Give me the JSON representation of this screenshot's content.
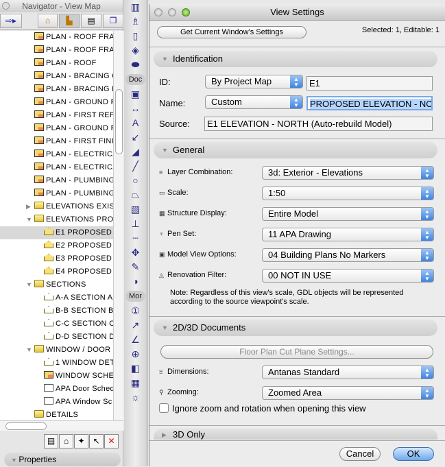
{
  "navigator": {
    "title": "Navigator - View Map",
    "properties_label": "Properties",
    "tree": [
      {
        "label": "PLAN - ROOF FRA",
        "type": "plan",
        "level": 2
      },
      {
        "label": "PLAN - ROOF FRA",
        "type": "plan",
        "level": 2
      },
      {
        "label": "PLAN - ROOF",
        "type": "plan",
        "level": 2
      },
      {
        "label": "PLAN - BRACING G",
        "type": "plan",
        "level": 2
      },
      {
        "label": "PLAN - BRACING F",
        "type": "plan",
        "level": 2
      },
      {
        "label": "PLAN - GROUND R",
        "type": "plan",
        "level": 2
      },
      {
        "label": "PLAN - FIRST REFL",
        "type": "plan",
        "level": 2
      },
      {
        "label": "PLAN - GROUND F",
        "type": "plan",
        "level": 2
      },
      {
        "label": "PLAN - FIRST FINIS",
        "type": "plan",
        "level": 2
      },
      {
        "label": "PLAN - ELECTRICA",
        "type": "plan",
        "level": 2
      },
      {
        "label": "PLAN - ELECTRICA",
        "type": "plan",
        "level": 2
      },
      {
        "label": "PLAN - PLUMBING",
        "type": "plan",
        "level": 2
      },
      {
        "label": "PLAN - PLUMBING",
        "type": "plan",
        "level": 2
      },
      {
        "label": "ELEVATIONS EXIST",
        "type": "folder",
        "level": 2,
        "arrow": "collapsed"
      },
      {
        "label": "ELEVATIONS PROP",
        "type": "folder",
        "level": 2,
        "arrow": "expanded"
      },
      {
        "label": "E1 PROPOSED E",
        "type": "elev",
        "level": 3,
        "selected": true
      },
      {
        "label": "E2 PROPOSED E",
        "type": "elev",
        "level": 3
      },
      {
        "label": "E3 PROPOSED E",
        "type": "elev",
        "level": 3
      },
      {
        "label": "E4 PROPOSED E",
        "type": "elev",
        "level": 3
      },
      {
        "label": "SECTIONS",
        "type": "folder",
        "level": 2,
        "arrow": "expanded"
      },
      {
        "label": "A-A SECTION A",
        "type": "sect",
        "level": 3
      },
      {
        "label": "B-B SECTION B-",
        "type": "sect",
        "level": 3
      },
      {
        "label": "C-C SECTION C",
        "type": "sect",
        "level": 3
      },
      {
        "label": "D-D SECTION D",
        "type": "sect",
        "level": 3
      },
      {
        "label": "WINDOW / DOOR",
        "type": "folder",
        "level": 2,
        "arrow": "expanded"
      },
      {
        "label": "1 WINDOW DET",
        "type": "sect",
        "level": 3
      },
      {
        "label": "WINDOW SCHED",
        "type": "plan",
        "level": 3
      },
      {
        "label": "APA Door Sched",
        "type": "doc",
        "level": 3
      },
      {
        "label": "APA Window Sc",
        "type": "doc",
        "level": 3
      },
      {
        "label": "DETAILS",
        "type": "folder",
        "level": 2
      }
    ]
  },
  "toolbox": {
    "doc_label": "Doc",
    "more_label": "Mor"
  },
  "dialog": {
    "title": "View Settings",
    "get_settings_label": "Get Current Window's Settings",
    "selection_status": "Selected: 1, Editable: 1",
    "identification": {
      "header": "Identification",
      "id_label": "ID:",
      "id_mode": "By Project Map",
      "id_value": "E1",
      "name_label": "Name:",
      "name_mode": "Custom",
      "name_value": "PROPOSED ELEVATION - NORTH",
      "source_label": "Source:",
      "source_value": "E1 ELEVATION - NORTH (Auto-rebuild Model)"
    },
    "general": {
      "header": "General",
      "rows": [
        {
          "label": "Layer Combination:",
          "value": "3d: Exterior - Elevations",
          "icon": "layers-icon",
          "glyph": "≡"
        },
        {
          "label": "Scale:",
          "value": "1:50",
          "icon": "scale-icon",
          "glyph": "▭"
        },
        {
          "label": "Structure Display:",
          "value": "Entire Model",
          "icon": "structure-icon",
          "glyph": "▦"
        },
        {
          "label": "Pen Set:",
          "value": "11 APA Drawing",
          "icon": "pen-icon",
          "glyph": "♆"
        },
        {
          "label": "Model View Options:",
          "value": "04 Building Plans No Markers",
          "icon": "model-view-icon",
          "glyph": "▣"
        },
        {
          "label": "Renovation Filter:",
          "value": "00 NOT IN USE",
          "icon": "renovation-icon",
          "glyph": "◬"
        }
      ],
      "note": "Note: Regardless of this view's scale, GDL objects will be represented according to the source viewpoint's scale."
    },
    "documents": {
      "header": "2D/3D Documents",
      "cut_plane_label": "Floor Plan Cut Plane Settings...",
      "rows": [
        {
          "label": "Dimensions:",
          "value": "Antanas Standard",
          "icon": "dimensions-icon",
          "glyph": "⩸"
        },
        {
          "label": "Zooming:",
          "value": "Zoomed Area",
          "icon": "zoom-icon",
          "glyph": "⚲"
        }
      ],
      "ignore_zoom_label": "Ignore zoom and rotation when opening this view",
      "ignore_zoom_checked": false
    },
    "three_d": {
      "header": "3D Only"
    },
    "cancel_label": "Cancel",
    "ok_label": "OK"
  }
}
